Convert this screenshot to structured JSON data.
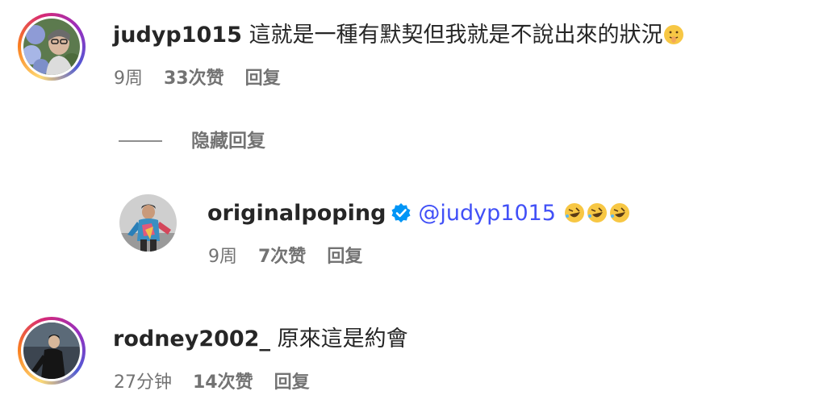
{
  "comments": [
    {
      "username": "judyp1015",
      "text": "這就是一種有默契但我就是不說出來的狀況",
      "emoji": "shushing-face-emoji",
      "time": "9周",
      "likes": "33次赞",
      "reply": "回复"
    },
    {
      "username": "rodney2002_",
      "text": "原來這是約會",
      "time": "27分钟",
      "likes": "14次赞",
      "reply": "回复"
    }
  ],
  "hide_replies": "隐藏回复",
  "reply": {
    "username": "originalpoping",
    "verified": true,
    "mention": "@judyp1015",
    "emoji": "rolling-on-the-floor-laughing-emoji",
    "emoji_count": 3,
    "time": "9周",
    "likes": "7次赞",
    "reply": "回复"
  },
  "colors": {
    "username": "#262626",
    "meta": "#737373",
    "mention": "#4150f7",
    "verified": "#0095f6"
  }
}
